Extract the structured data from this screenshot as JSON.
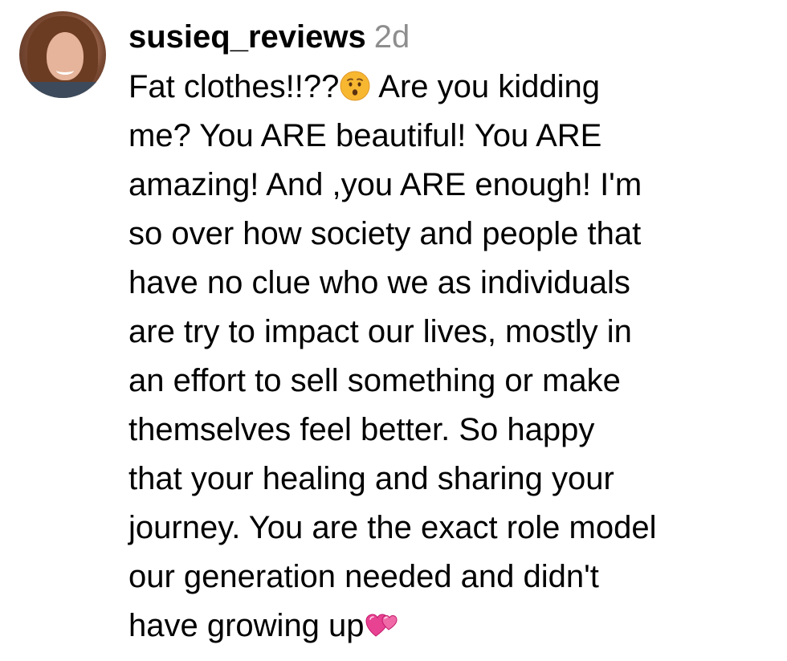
{
  "comment": {
    "username": "susieq_reviews",
    "timestamp": "2d",
    "lines": [
      {
        "before": "Fat clothes!!??",
        "emoji": "hushed-face-emoji",
        "after": " Are you kidding"
      },
      {
        "text": "me? You ARE beautiful! You ARE"
      },
      {
        "text": "amazing! And ,you ARE enough! I'm"
      },
      {
        "text": "so over how society and people that"
      },
      {
        "text": "have no clue who we as individuals"
      },
      {
        "text": "are try to impact our lives, mostly in"
      },
      {
        "text": "an effort to sell something or make"
      },
      {
        "text": "themselves feel better. So happy"
      },
      {
        "text": "that your healing and sharing your"
      },
      {
        "text": "journey. You are the exact role model"
      },
      {
        "text": "our generation needed and didn't"
      },
      {
        "before": "have growing up",
        "emoji": "two-hearts-emoji",
        "after": ""
      }
    ]
  },
  "colors": {
    "text": "#000000",
    "timestamp": "#8e8e8e",
    "emoji_face": "#f7b731",
    "emoji_heart": "#e84393"
  }
}
